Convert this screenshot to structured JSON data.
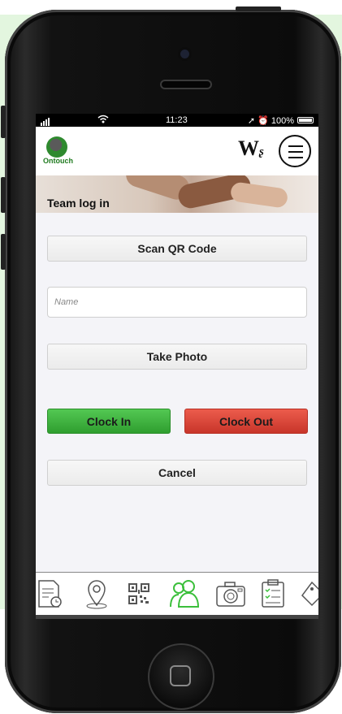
{
  "status_bar": {
    "time": "11:23",
    "battery": "100%"
  },
  "header": {
    "logo_text": "Ontouch",
    "w_logo": "W"
  },
  "banner": {
    "title": "Team log in"
  },
  "form": {
    "scan_qr_label": "Scan QR Code",
    "name_placeholder": "Name",
    "take_photo_label": "Take Photo",
    "clock_in_label": "Clock In",
    "clock_out_label": "Clock Out",
    "cancel_label": "Cancel"
  },
  "tab_bar": {
    "items": [
      {
        "icon": "timesheet-icon"
      },
      {
        "icon": "location-pin-icon"
      },
      {
        "icon": "qr-code-icon"
      },
      {
        "icon": "team-icon",
        "active": true
      },
      {
        "icon": "camera-icon"
      },
      {
        "icon": "checklist-icon"
      },
      {
        "icon": "tag-icon"
      }
    ]
  },
  "colors": {
    "brand_green": "#2f8a2f",
    "active_tab": "#3bbf3b",
    "clock_in": "#3fb33f",
    "clock_out": "#d9463a",
    "background_green": "#e3f6df"
  }
}
